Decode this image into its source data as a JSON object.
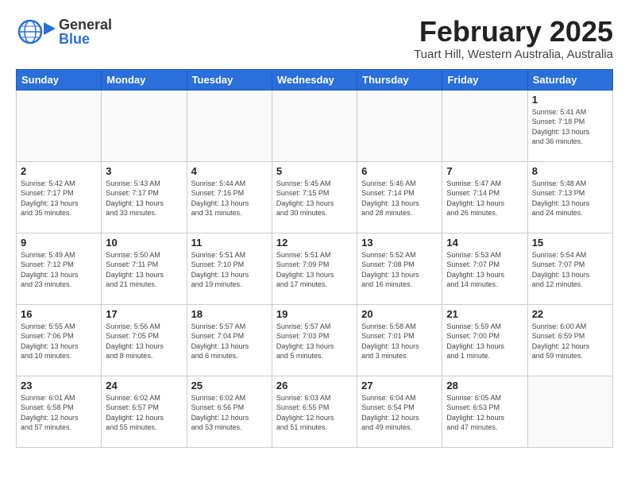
{
  "header": {
    "logo_general": "General",
    "logo_blue": "Blue",
    "month_title": "February 2025",
    "location": "Tuart Hill, Western Australia, Australia"
  },
  "weekdays": [
    "Sunday",
    "Monday",
    "Tuesday",
    "Wednesday",
    "Thursday",
    "Friday",
    "Saturday"
  ],
  "weeks": [
    [
      {
        "day": "",
        "info": ""
      },
      {
        "day": "",
        "info": ""
      },
      {
        "day": "",
        "info": ""
      },
      {
        "day": "",
        "info": ""
      },
      {
        "day": "",
        "info": ""
      },
      {
        "day": "",
        "info": ""
      },
      {
        "day": "1",
        "info": "Sunrise: 5:41 AM\nSunset: 7:18 PM\nDaylight: 13 hours\nand 36 minutes."
      }
    ],
    [
      {
        "day": "2",
        "info": "Sunrise: 5:42 AM\nSunset: 7:17 PM\nDaylight: 13 hours\nand 35 minutes."
      },
      {
        "day": "3",
        "info": "Sunrise: 5:43 AM\nSunset: 7:17 PM\nDaylight: 13 hours\nand 33 minutes."
      },
      {
        "day": "4",
        "info": "Sunrise: 5:44 AM\nSunset: 7:16 PM\nDaylight: 13 hours\nand 31 minutes."
      },
      {
        "day": "5",
        "info": "Sunrise: 5:45 AM\nSunset: 7:15 PM\nDaylight: 13 hours\nand 30 minutes."
      },
      {
        "day": "6",
        "info": "Sunrise: 5:46 AM\nSunset: 7:14 PM\nDaylight: 13 hours\nand 28 minutes."
      },
      {
        "day": "7",
        "info": "Sunrise: 5:47 AM\nSunset: 7:14 PM\nDaylight: 13 hours\nand 26 minutes."
      },
      {
        "day": "8",
        "info": "Sunrise: 5:48 AM\nSunset: 7:13 PM\nDaylight: 13 hours\nand 24 minutes."
      }
    ],
    [
      {
        "day": "9",
        "info": "Sunrise: 5:49 AM\nSunset: 7:12 PM\nDaylight: 13 hours\nand 23 minutes."
      },
      {
        "day": "10",
        "info": "Sunrise: 5:50 AM\nSunset: 7:11 PM\nDaylight: 13 hours\nand 21 minutes."
      },
      {
        "day": "11",
        "info": "Sunrise: 5:51 AM\nSunset: 7:10 PM\nDaylight: 13 hours\nand 19 minutes."
      },
      {
        "day": "12",
        "info": "Sunrise: 5:51 AM\nSunset: 7:09 PM\nDaylight: 13 hours\nand 17 minutes."
      },
      {
        "day": "13",
        "info": "Sunrise: 5:52 AM\nSunset: 7:08 PM\nDaylight: 13 hours\nand 16 minutes."
      },
      {
        "day": "14",
        "info": "Sunrise: 5:53 AM\nSunset: 7:07 PM\nDaylight: 13 hours\nand 14 minutes."
      },
      {
        "day": "15",
        "info": "Sunrise: 5:54 AM\nSunset: 7:07 PM\nDaylight: 13 hours\nand 12 minutes."
      }
    ],
    [
      {
        "day": "16",
        "info": "Sunrise: 5:55 AM\nSunset: 7:06 PM\nDaylight: 13 hours\nand 10 minutes."
      },
      {
        "day": "17",
        "info": "Sunrise: 5:56 AM\nSunset: 7:05 PM\nDaylight: 13 hours\nand 8 minutes."
      },
      {
        "day": "18",
        "info": "Sunrise: 5:57 AM\nSunset: 7:04 PM\nDaylight: 13 hours\nand 6 minutes."
      },
      {
        "day": "19",
        "info": "Sunrise: 5:57 AM\nSunset: 7:03 PM\nDaylight: 13 hours\nand 5 minutes."
      },
      {
        "day": "20",
        "info": "Sunrise: 5:58 AM\nSunset: 7:01 PM\nDaylight: 13 hours\nand 3 minutes."
      },
      {
        "day": "21",
        "info": "Sunrise: 5:59 AM\nSunset: 7:00 PM\nDaylight: 13 hours\nand 1 minute."
      },
      {
        "day": "22",
        "info": "Sunrise: 6:00 AM\nSunset: 6:59 PM\nDaylight: 12 hours\nand 59 minutes."
      }
    ],
    [
      {
        "day": "23",
        "info": "Sunrise: 6:01 AM\nSunset: 6:58 PM\nDaylight: 12 hours\nand 57 minutes."
      },
      {
        "day": "24",
        "info": "Sunrise: 6:02 AM\nSunset: 6:57 PM\nDaylight: 12 hours\nand 55 minutes."
      },
      {
        "day": "25",
        "info": "Sunrise: 6:02 AM\nSunset: 6:56 PM\nDaylight: 12 hours\nand 53 minutes."
      },
      {
        "day": "26",
        "info": "Sunrise: 6:03 AM\nSunset: 6:55 PM\nDaylight: 12 hours\nand 51 minutes."
      },
      {
        "day": "27",
        "info": "Sunrise: 6:04 AM\nSunset: 6:54 PM\nDaylight: 12 hours\nand 49 minutes."
      },
      {
        "day": "28",
        "info": "Sunrise: 6:05 AM\nSunset: 6:53 PM\nDaylight: 12 hours\nand 47 minutes."
      },
      {
        "day": "",
        "info": ""
      }
    ]
  ]
}
